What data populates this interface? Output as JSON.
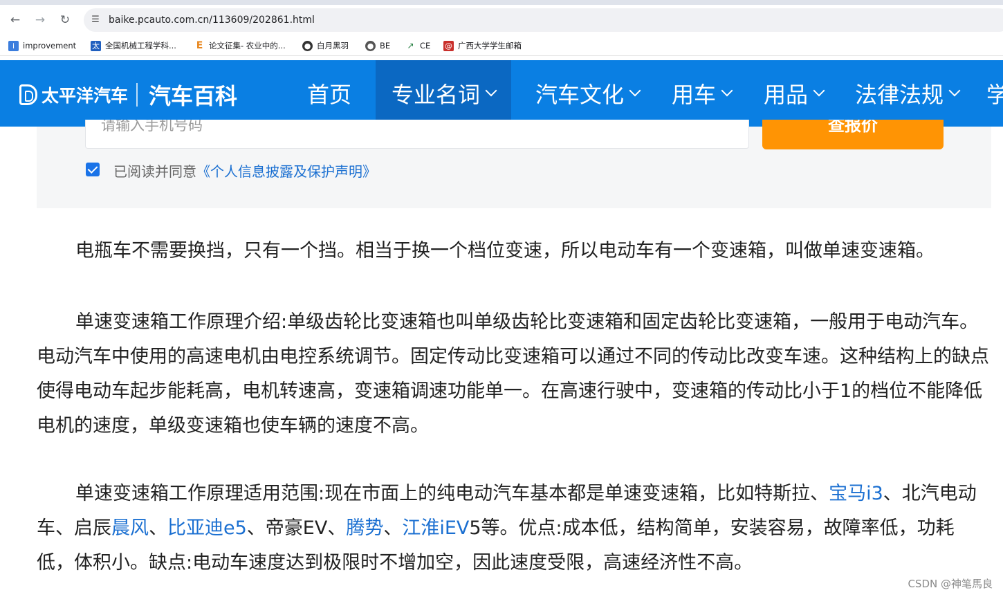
{
  "browser": {
    "url": "baike.pcauto.com.cn/113609/202861.html",
    "bookmarks": [
      {
        "label": "improvement",
        "icon": "improvement-icon",
        "color": "#3b7ddd"
      },
      {
        "label": "全国机械工程学科...",
        "icon": "tai-icon",
        "color": "#1f5fbf"
      },
      {
        "label": "论文征集- 农业中的...",
        "icon": "e-icon",
        "color": "#e8871e"
      },
      {
        "label": "白月黑羽",
        "icon": "bird-icon",
        "color": "#333333"
      },
      {
        "label": "BE",
        "icon": "globe-icon",
        "color": "#555555"
      },
      {
        "label": "CE",
        "icon": "ce-icon",
        "color": "#1d7a3a"
      },
      {
        "label": "广西大学学生邮箱",
        "icon": "mail-icon",
        "color": "#c9302c"
      }
    ]
  },
  "site": {
    "brand": "太平洋汽车",
    "section": "汽车百科",
    "nav": [
      {
        "label": "首页",
        "has_menu": false
      },
      {
        "label": "专业名词",
        "has_menu": true
      },
      {
        "label": "汽车文化",
        "has_menu": true
      },
      {
        "label": "用车",
        "has_menu": true
      },
      {
        "label": "用品",
        "has_menu": true
      },
      {
        "label": "法律法规",
        "has_menu": true
      },
      {
        "label": "学",
        "has_menu": false
      }
    ],
    "accent": "#0a7fe3",
    "accent_active": "#0b68c2"
  },
  "form": {
    "phone_placeholder": "请输入手机号码",
    "query_button": "查报价",
    "agree_checked": true,
    "agree_text": "已阅读并同意",
    "agree_link": "《个人信息披露及保护声明》",
    "button_color": "#ff9404"
  },
  "article": {
    "p1": "电瓶车不需要换挡，只有一个挡。相当于换一个档位变速，所以电动车有一个变速箱，叫做单速变速箱。",
    "p2": "单速变速箱工作原理介绍:单级齿轮比变速箱也叫单级齿轮比变速箱和固定齿轮比变速箱，一般用于电动汽车。电动汽车中使用的高速电机由电控系统调节。固定传动比变速箱可以通过不同的传动比改变车速。这种结构上的缺点使得电动车起步能耗高，电机转速高，变速箱调速功能单一。在高速行驶中，变速箱的传动比小于1的档位不能降低电机的速度，单级变速箱也使车辆的速度不高。",
    "p3": {
      "t1": "单速变速箱工作原理适用范围:现在市面上的纯电动汽车基本都是单速变速箱，比如特斯拉、",
      "link1": "宝马i3",
      "t2": "、北汽电动车、启辰",
      "link2": "晨风",
      "t3": "、",
      "link3": "比亚迪e5",
      "t4": "、帝豪EV、",
      "link4": "腾势",
      "t5": "、",
      "link5": "江淮iEV",
      "t6": "5等。优点:成本低，结构简单，安装容易，故障率低，功耗低，体积小。缺点:电动车速度达到极限时不增加空，因此速度受限，高速经济性不高。"
    },
    "link_color": "#1a6fd1"
  },
  "watermark": "CSDN @神笔馬良"
}
